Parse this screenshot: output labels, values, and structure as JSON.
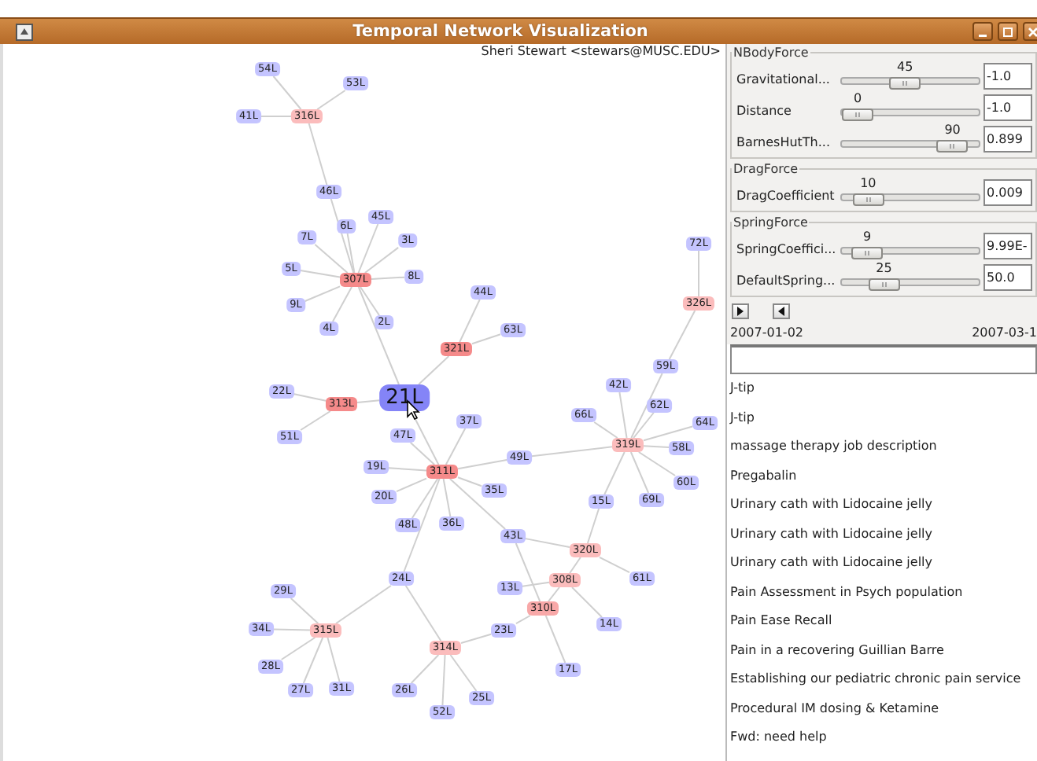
{
  "window": {
    "title": "Temporal Network Visualization"
  },
  "user": "Sheri Stewart <stewars@MUSC.EDU>",
  "graph": {
    "nodes": [
      {
        "label": "54L",
        "kind": "leaf",
        "color": "#c4c4ff"
      },
      {
        "label": "53L",
        "kind": "leaf",
        "color": "#c4c4ff"
      },
      {
        "label": "41L",
        "kind": "leaf",
        "color": "#c4c4ff"
      },
      {
        "label": "316L",
        "kind": "hub",
        "color": "#fbbcbc"
      },
      {
        "label": "46L",
        "kind": "leaf",
        "color": "#c4c4ff"
      },
      {
        "label": "6L",
        "kind": "leaf",
        "color": "#c4c4ff"
      },
      {
        "label": "45L",
        "kind": "leaf",
        "color": "#c4c4ff"
      },
      {
        "label": "7L",
        "kind": "leaf",
        "color": "#c4c4ff"
      },
      {
        "label": "3L",
        "kind": "leaf",
        "color": "#c4c4ff"
      },
      {
        "label": "5L",
        "kind": "leaf",
        "color": "#c4c4ff"
      },
      {
        "label": "307L",
        "kind": "hub",
        "color": "#f58a8a"
      },
      {
        "label": "8L",
        "kind": "leaf",
        "color": "#c4c4ff"
      },
      {
        "label": "9L",
        "kind": "leaf",
        "color": "#c4c4ff"
      },
      {
        "label": "4L",
        "kind": "leaf",
        "color": "#c4c4ff"
      },
      {
        "label": "2L",
        "kind": "leaf",
        "color": "#c4c4ff"
      },
      {
        "label": "44L",
        "kind": "leaf",
        "color": "#c4c4ff"
      },
      {
        "label": "63L",
        "kind": "leaf",
        "color": "#c4c4ff"
      },
      {
        "label": "321L",
        "kind": "hub",
        "color": "#f58a8a"
      },
      {
        "label": "72L",
        "kind": "leaf",
        "color": "#c4c4ff"
      },
      {
        "label": "326L",
        "kind": "hub",
        "color": "#fbbcbc"
      },
      {
        "label": "59L",
        "kind": "leaf",
        "color": "#c4c4ff"
      },
      {
        "label": "42L",
        "kind": "leaf",
        "color": "#c4c4ff"
      },
      {
        "label": "22L",
        "kind": "leaf",
        "color": "#c4c4ff"
      },
      {
        "label": "313L",
        "kind": "hub",
        "color": "#f58a8a"
      },
      {
        "label": "21L",
        "kind": "focus",
        "color": "#8484f7"
      },
      {
        "label": "62L",
        "kind": "leaf",
        "color": "#c4c4ff"
      },
      {
        "label": "66L",
        "kind": "leaf",
        "color": "#c4c4ff"
      },
      {
        "label": "37L",
        "kind": "leaf",
        "color": "#c4c4ff"
      },
      {
        "label": "64L",
        "kind": "leaf",
        "color": "#c4c4ff"
      },
      {
        "label": "47L",
        "kind": "leaf",
        "color": "#c4c4ff"
      },
      {
        "label": "51L",
        "kind": "leaf",
        "color": "#c4c4ff"
      },
      {
        "label": "319L",
        "kind": "hub",
        "color": "#fbbcbc"
      },
      {
        "label": "58L",
        "kind": "leaf",
        "color": "#c4c4ff"
      },
      {
        "label": "49L",
        "kind": "leaf",
        "color": "#c4c4ff"
      },
      {
        "label": "19L",
        "kind": "leaf",
        "color": "#c4c4ff"
      },
      {
        "label": "311L",
        "kind": "hub",
        "color": "#f58a8a"
      },
      {
        "label": "60L",
        "kind": "leaf",
        "color": "#c4c4ff"
      },
      {
        "label": "35L",
        "kind": "leaf",
        "color": "#c4c4ff"
      },
      {
        "label": "20L",
        "kind": "leaf",
        "color": "#c4c4ff"
      },
      {
        "label": "15L",
        "kind": "leaf",
        "color": "#c4c4ff"
      },
      {
        "label": "69L",
        "kind": "leaf",
        "color": "#c4c4ff"
      },
      {
        "label": "48L",
        "kind": "leaf",
        "color": "#c4c4ff"
      },
      {
        "label": "36L",
        "kind": "leaf",
        "color": "#c4c4ff"
      },
      {
        "label": "43L",
        "kind": "leaf",
        "color": "#c4c4ff"
      },
      {
        "label": "320L",
        "kind": "hub",
        "color": "#fbbcbc"
      },
      {
        "label": "24L",
        "kind": "leaf",
        "color": "#c4c4ff"
      },
      {
        "label": "308L",
        "kind": "hub",
        "color": "#fbbcbc"
      },
      {
        "label": "61L",
        "kind": "leaf",
        "color": "#c4c4ff"
      },
      {
        "label": "13L",
        "kind": "leaf",
        "color": "#c4c4ff"
      },
      {
        "label": "29L",
        "kind": "leaf",
        "color": "#c4c4ff"
      },
      {
        "label": "310L",
        "kind": "hub",
        "color": "#f8a8a8"
      },
      {
        "label": "14L",
        "kind": "leaf",
        "color": "#c4c4ff"
      },
      {
        "label": "34L",
        "kind": "leaf",
        "color": "#c4c4ff"
      },
      {
        "label": "315L",
        "kind": "hub",
        "color": "#fbbcbc"
      },
      {
        "label": "23L",
        "kind": "leaf",
        "color": "#c4c4ff"
      },
      {
        "label": "314L",
        "kind": "hub",
        "color": "#fbbcbc"
      },
      {
        "label": "28L",
        "kind": "leaf",
        "color": "#c4c4ff"
      },
      {
        "label": "17L",
        "kind": "leaf",
        "color": "#c4c4ff"
      },
      {
        "label": "27L",
        "kind": "leaf",
        "color": "#c4c4ff"
      },
      {
        "label": "31L",
        "kind": "leaf",
        "color": "#c4c4ff"
      },
      {
        "label": "26L",
        "kind": "leaf",
        "color": "#c4c4ff"
      },
      {
        "label": "25L",
        "kind": "leaf",
        "color": "#c4c4ff"
      },
      {
        "label": "52L",
        "kind": "leaf",
        "color": "#c4c4ff"
      }
    ]
  },
  "force_groups": [
    {
      "title": "NBodyForce",
      "params": [
        {
          "label": "Gravitational...",
          "value": "45",
          "level": 0.45,
          "field": "-1.0"
        },
        {
          "label": "Distance",
          "value": "0",
          "level": 0,
          "field": "-1.0"
        },
        {
          "label": "BarnesHutTh...",
          "value": "90",
          "level": 0.9,
          "field": "0.899"
        }
      ]
    },
    {
      "title": "DragForce",
      "params": [
        {
          "label": "DragCoefficient",
          "value": "10",
          "level": 0.1,
          "field": "0.009"
        }
      ]
    },
    {
      "title": "SpringForce",
      "params": [
        {
          "label": "SpringCoeffici...",
          "value": "9",
          "level": 0.09,
          "field": "9.99E-"
        },
        {
          "label": "DefaultSpring...",
          "value": "25",
          "level": 0.25,
          "field": "50.0"
        }
      ]
    }
  ],
  "timeline": {
    "start": "2007-01-02",
    "end": "2007-03-1"
  },
  "messages": [
    "J-tip",
    "J-tip",
    "massage therapy job description",
    "Pregabalin",
    "Urinary cath with Lidocaine jelly",
    "Urinary cath with Lidocaine jelly",
    "Urinary cath with Lidocaine jelly",
    "Pain Assessment in Psych population",
    "Pain Ease Recall",
    "Pain in a recovering Guillian Barre",
    "Establishing our pediatric chronic pain service",
    "Procedural IM dosing & Ketamine",
    "Fwd: need help"
  ]
}
